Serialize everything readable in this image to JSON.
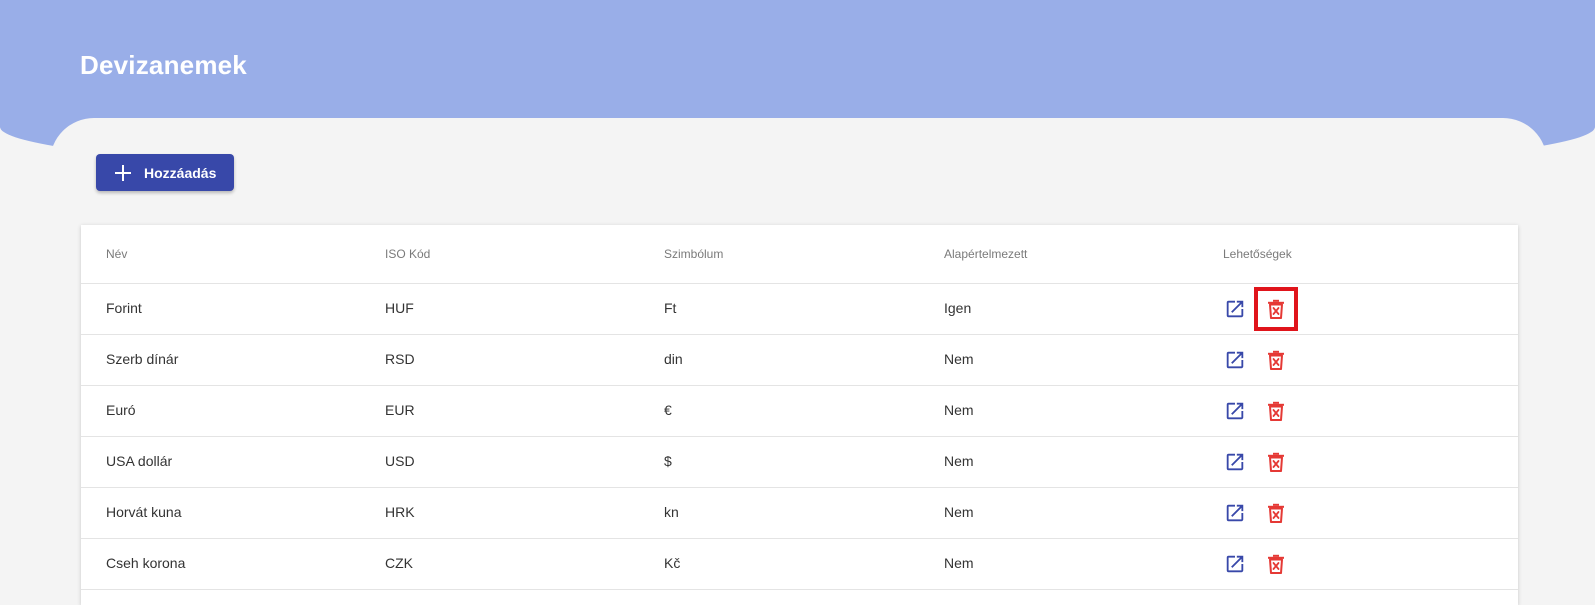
{
  "page": {
    "title": "Devizanemek"
  },
  "toolbar": {
    "add_label": "Hozzáadás",
    "add_icon": "plus-icon"
  },
  "table": {
    "columns": [
      "Név",
      "ISO Kód",
      "Szimbólum",
      "Alapértelmezett",
      "Lehetőségek"
    ],
    "rows": [
      {
        "name": "Forint",
        "iso": "HUF",
        "symbol": "Ft",
        "default": "Igen"
      },
      {
        "name": "Szerb dínár",
        "iso": "RSD",
        "symbol": "din",
        "default": "Nem"
      },
      {
        "name": "Euró",
        "iso": "EUR",
        "symbol": "€",
        "default": "Nem"
      },
      {
        "name": "USA dollár",
        "iso": "USD",
        "symbol": "$",
        "default": "Nem"
      },
      {
        "name": "Horvát kuna",
        "iso": "HRK",
        "symbol": "kn",
        "default": "Nem"
      },
      {
        "name": "Cseh korona",
        "iso": "CZK",
        "symbol": "Kč",
        "default": "Nem"
      }
    ],
    "actions": {
      "edit_icon": "open-in-new-icon",
      "delete_icon": "delete-forever-icon"
    }
  },
  "colors": {
    "header_bg": "#99aee8",
    "primary": "#3848a9",
    "edit_icon": "#3848a9",
    "delete_icon": "#e53935",
    "highlight": "#e0141b"
  }
}
